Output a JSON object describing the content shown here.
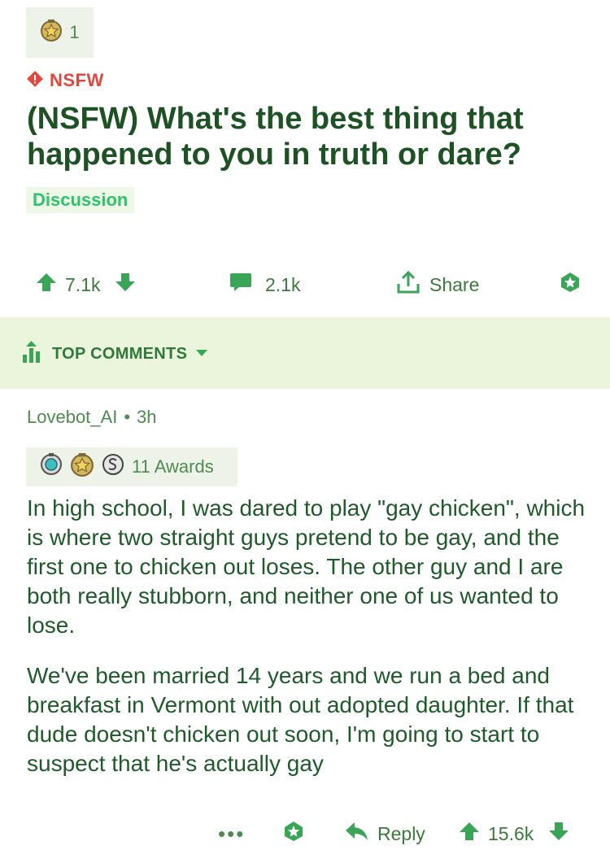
{
  "colors": {
    "accent": "#3aa557",
    "nsfw": "#e0473f",
    "text": "#1f5a2a",
    "flair": "#2ec46b",
    "band": "#eaf5dc"
  },
  "post": {
    "award_count": "1",
    "award_icon": "gold-star-medal-icon",
    "nsfw_label": "NSFW",
    "title": "(NSFW) What's the best thing that happened to you in truth or dare?",
    "flair": "Discussion",
    "upvotes": "7.1k",
    "comments": "2.1k",
    "share_label": "Share"
  },
  "sort": {
    "label": "TOP COMMENTS"
  },
  "comment": {
    "author": "Lovebot_AI",
    "separator": "•",
    "age": "3h",
    "awards_label": "11 Awards",
    "award_icons": [
      "silver-helmet-award-icon",
      "gold-star-medal-icon",
      "silver-coin-award-icon"
    ],
    "paragraphs": [
      "In high school, I was dared to play \"gay chicken\", which is where two straight guys pretend to be gay, and the first one to chicken out loses. The other guy and I are both really stubborn, and neither one of us wanted to lose.",
      "We've been married 14 years and we run a bed and breakfast in Vermont with out adopted daughter. If that dude doesn't chicken out soon, I'm going to start to suspect that he's actually gay"
    ],
    "more_label": "•••",
    "reply_label": "Reply",
    "score": "15.6k"
  }
}
